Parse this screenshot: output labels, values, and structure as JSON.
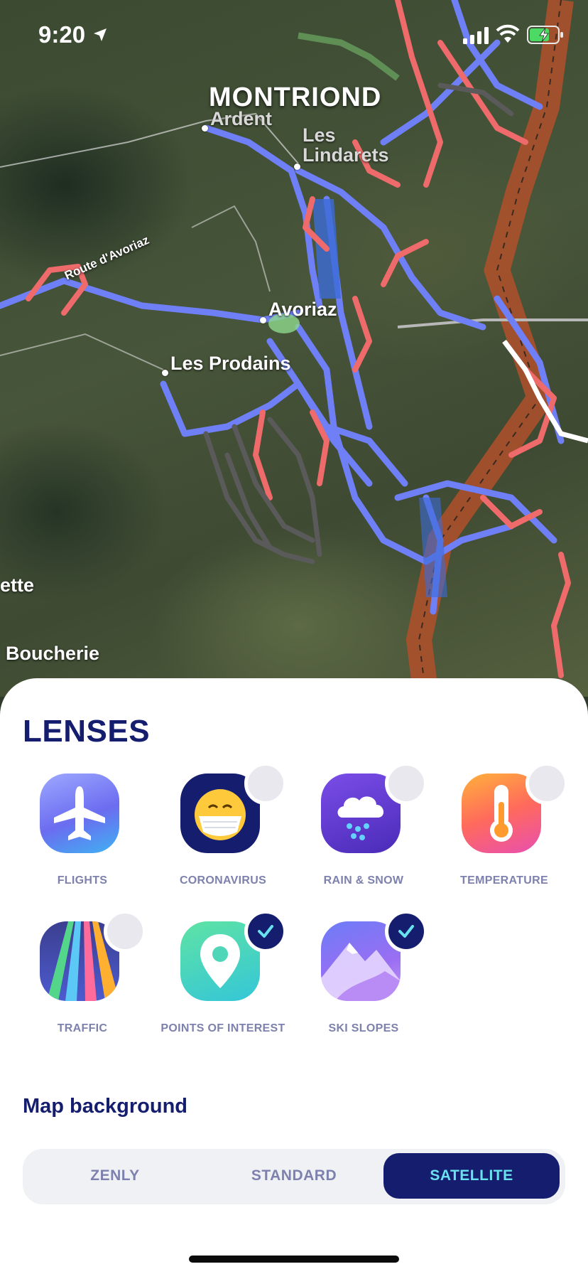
{
  "status_bar": {
    "time": "9:20"
  },
  "map": {
    "region_label": "MONTRIOND",
    "road_label": "Route d'Avoriaz",
    "places": [
      "Ardent",
      "Les Lindarets",
      "Avoriaz",
      "Les Prodains",
      "ette",
      "Boucherie"
    ],
    "colors": {
      "blue_run": "#6f7ff6",
      "red_run": "#ef6a6a",
      "black_run": "#5a5a5a",
      "lift": "#b0502a"
    }
  },
  "lenses": {
    "title": "LENSES",
    "items": [
      {
        "label": "FLIGHTS",
        "icon": "airplane-icon",
        "enabled": null
      },
      {
        "label": "CORONAVIRUS",
        "icon": "face-mask-icon",
        "enabled": false
      },
      {
        "label": "RAIN & SNOW",
        "icon": "rain-cloud-icon",
        "enabled": false
      },
      {
        "label": "TEMPERATURE",
        "icon": "thermometer-icon",
        "enabled": false
      },
      {
        "label": "TRAFFIC",
        "icon": "road-lanes-icon",
        "enabled": false
      },
      {
        "label": "POINTS OF INTEREST",
        "icon": "map-pin-icon",
        "enabled": true
      },
      {
        "label": "SKI SLOPES",
        "icon": "mountain-icon",
        "enabled": true
      }
    ]
  },
  "map_background": {
    "title": "Map background",
    "options": [
      "ZENLY",
      "STANDARD",
      "SATELLITE"
    ],
    "selected": "SATELLITE"
  },
  "theme": {
    "accent": "#151e6e",
    "accent_text": "#67e2ee",
    "label_color": "#7d81ad"
  }
}
